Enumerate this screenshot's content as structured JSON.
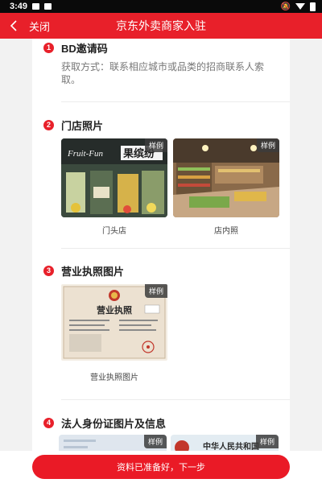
{
  "status_bar": {
    "time": "3:49"
  },
  "nav": {
    "close_label": "关闭",
    "title": "京东外卖商家入驻"
  },
  "sections": [
    {
      "number": "1",
      "title": "BD邀请码",
      "description": "获取方式：联系相应城市或品类的招商联系人索取。"
    },
    {
      "number": "2",
      "title": "门店照片",
      "photos": [
        {
          "tag": "样例",
          "caption": "门头店"
        },
        {
          "tag": "样例",
          "caption": "店内照"
        }
      ]
    },
    {
      "number": "3",
      "title": "营业执照图片",
      "photos": [
        {
          "tag": "样例",
          "caption": "营业执照图片"
        }
      ]
    },
    {
      "number": "4",
      "title": "法人身份证图片及信息",
      "photos": [
        {
          "tag": "样例"
        },
        {
          "tag": "样例"
        }
      ]
    }
  ],
  "storefront_sign": {
    "brand_en": "Fruit-Fun",
    "brand_cn": "果缤纷"
  },
  "license_sample": {
    "heading": "营业执照"
  },
  "id_card_sample": {
    "heading": "中华人民共和国"
  },
  "footer": {
    "cta_label": "资料已准备好，下一步"
  },
  "colors": {
    "accent": "#e8202a",
    "status_bar": "#0a0a0a"
  }
}
